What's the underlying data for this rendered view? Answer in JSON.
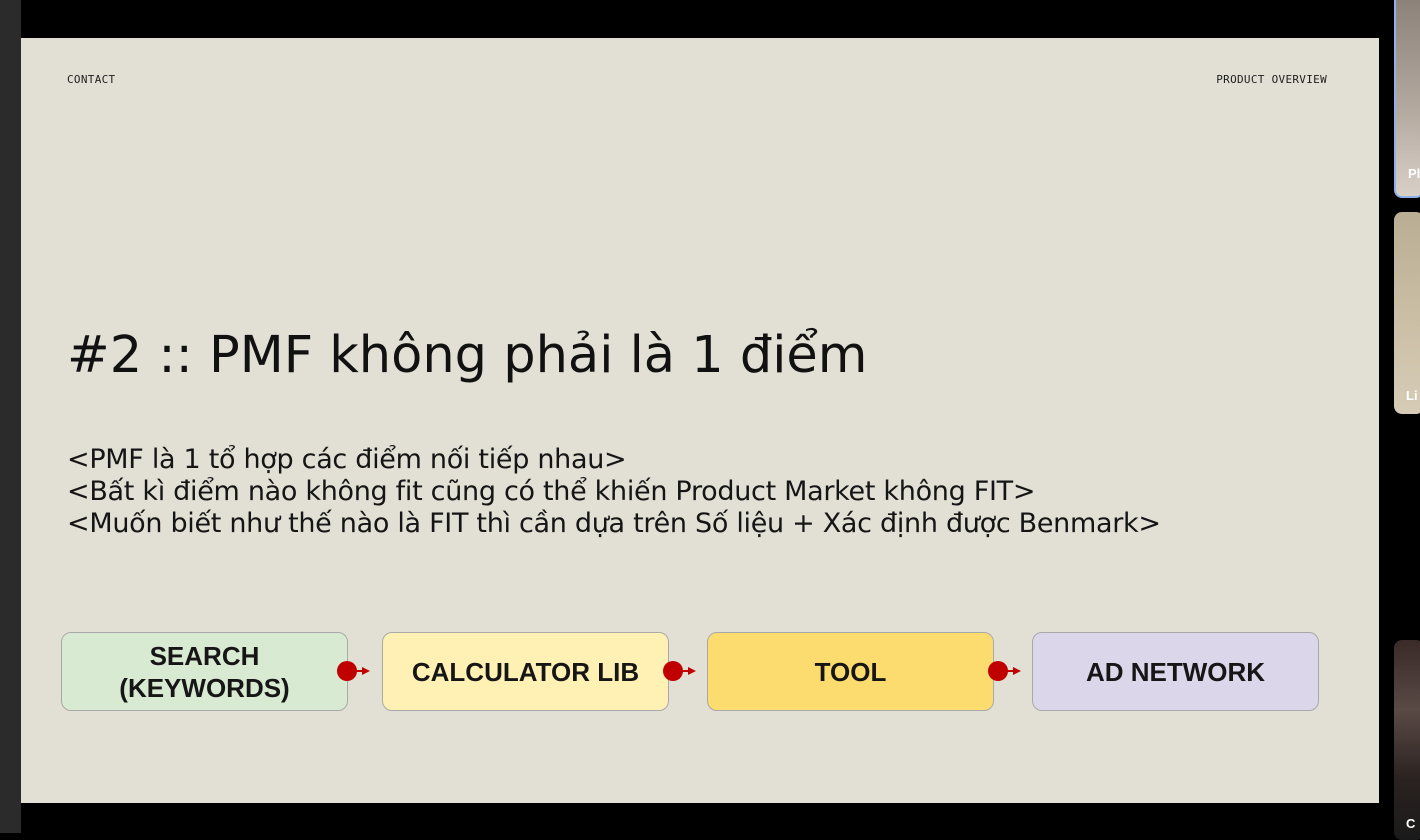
{
  "slide": {
    "header_left": "CONTACT",
    "header_right": "PRODUCT OVERVIEW",
    "title": "#2 :: PMF không phải là 1 điểm",
    "subtitle_lines": [
      "<PMF là 1 tổ hợp các điểm nối tiếp nhau>",
      "<Bất kì điểm nào không fit cũng có thể khiến Product Market không FIT>",
      "<Muốn biết như thế nào là FIT thì cần dựa trên Số liệu + Xác định được Benmark>"
    ],
    "flow": [
      {
        "label": "SEARCH\n(KEYWORDS)",
        "color": "#d9ead3"
      },
      {
        "label": "CALCULATOR LIB",
        "color": "#fff1b3"
      },
      {
        "label": "TOOL",
        "color": "#fcdc6e"
      },
      {
        "label": "AD NETWORK",
        "color": "#dcd6ea"
      }
    ],
    "connector_color": "#c00000",
    "background": "#e2dfd4"
  },
  "participants": [
    {
      "name": "Ph"
    },
    {
      "name": "Li"
    },
    {
      "name": "C"
    }
  ]
}
